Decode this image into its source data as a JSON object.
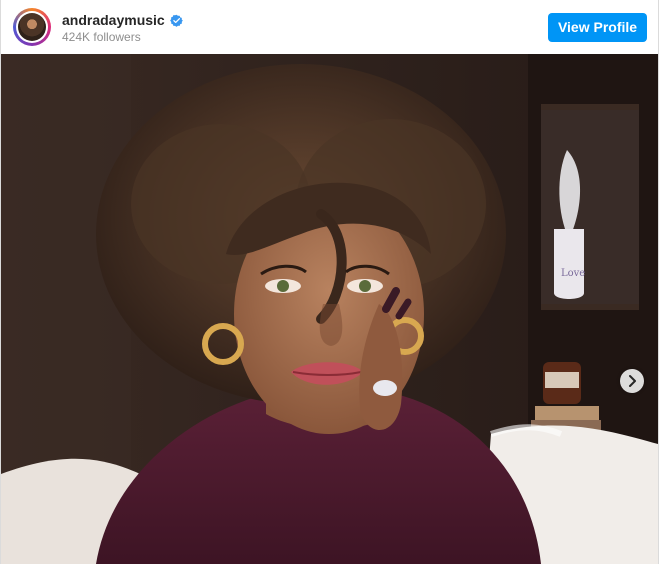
{
  "profile": {
    "username": "andradaymusic",
    "followers": "424K followers",
    "verified_icon": "verified-badge-icon",
    "avatar_icon": "profile-avatar"
  },
  "actions": {
    "view_profile_label": "View Profile"
  },
  "carousel": {
    "next_icon": "chevron-right-icon"
  },
  "colors": {
    "accent": "#0095f6",
    "username": "#262626",
    "secondary_text": "#8e8e8e"
  }
}
